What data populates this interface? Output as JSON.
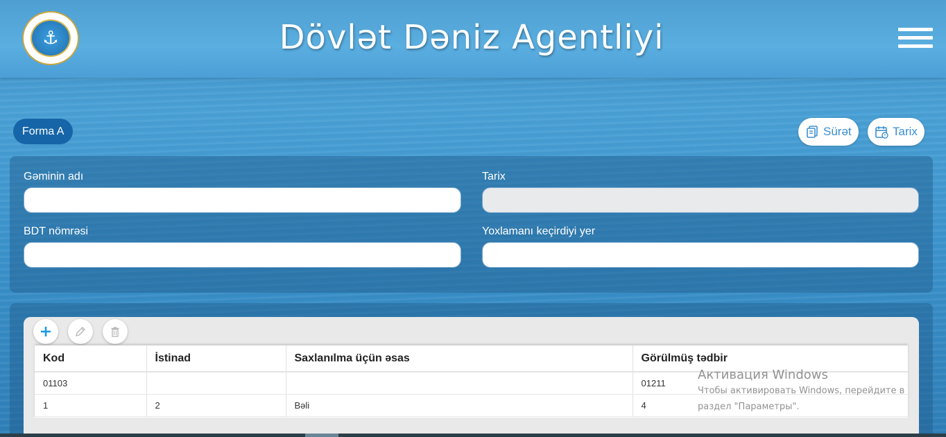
{
  "header": {
    "title": "Dövlət Dəniz Agentliyi",
    "logo_glyph": "⚓"
  },
  "form": {
    "badge": "Forma A",
    "actions": {
      "copy_label": "Sürət",
      "date_label": "Tarix"
    },
    "fields": {
      "ship_name_label": "Gəminin adı",
      "date_label": "Tarix",
      "bdt_label": "BDT nömrəsi",
      "place_label": "Yoxlamanı keçirdiyi yer"
    }
  },
  "grid": {
    "columns": [
      "Kod",
      "İstinad",
      "Saxlanılma üçün əsas",
      "Görülmüş tədbir"
    ],
    "rows": [
      [
        "01103",
        "",
        "",
        "01211"
      ],
      [
        "1",
        "2",
        "Bəli",
        "4"
      ]
    ]
  },
  "watermark": {
    "title": "Активация Windows",
    "line1": "Чтобы активировать Windows, перейдите в",
    "line2": "раздел \"Параметры\"."
  },
  "colors": {
    "accent": "#3a8fd0",
    "badge": "#1565a8",
    "add_icon": "#1a9be0"
  }
}
